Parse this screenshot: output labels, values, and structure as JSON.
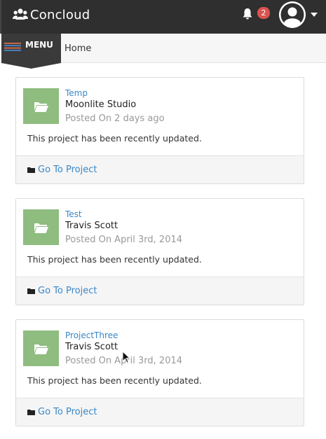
{
  "header": {
    "brand": "Concloud",
    "notification_count": "2"
  },
  "menu": {
    "label": "MENU"
  },
  "breadcrumb": {
    "current": "Home"
  },
  "projects": [
    {
      "name": "Temp",
      "owner": "Moonlite Studio",
      "posted": "Posted On 2 days ago",
      "description": "This project has been recently updated.",
      "action": "Go To Project"
    },
    {
      "name": "Test",
      "owner": "Travis Scott",
      "posted": "Posted On April 3rd, 2014",
      "description": "This project has been recently updated.",
      "action": "Go To Project"
    },
    {
      "name": "ProjectThree",
      "owner": "Travis Scott",
      "posted": "Posted On April 3rd, 2014",
      "description": "This project has been recently updated.",
      "action": "Go To Project"
    }
  ],
  "colors": {
    "topbar": "#2f2f2f",
    "accent_link": "#3a87c7",
    "badge": "#d9534f",
    "thumb": "#8fbc7f"
  },
  "icons": [
    "users-icon",
    "bell-icon",
    "user-avatar-icon",
    "caret-down-icon",
    "menu-lines-icon",
    "folder-open-icon",
    "folder-icon",
    "mouse-cursor-icon"
  ]
}
